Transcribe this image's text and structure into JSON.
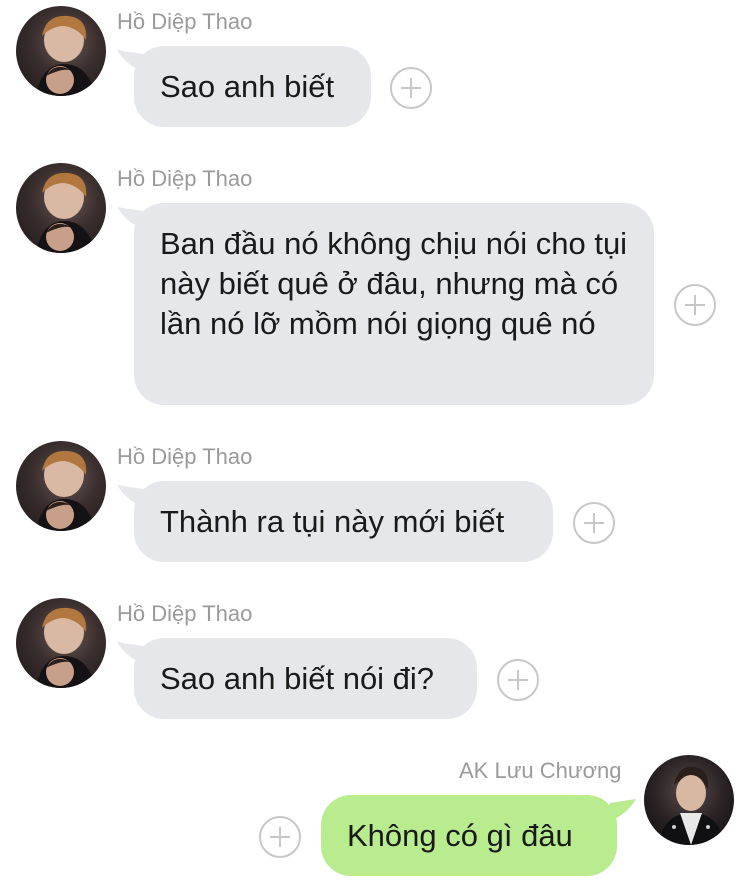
{
  "messages": [
    {
      "sender": "Hồ Diệp Thao",
      "text": "Sao anh biết",
      "direction": "incoming"
    },
    {
      "sender": "Hồ Diệp Thao",
      "text": "Ban đầu nó không chịu nói cho tụi này biết quê ở đâu, nhưng mà có lần nó lỡ mồm nói giọng quê nó",
      "direction": "incoming"
    },
    {
      "sender": "Hồ Diệp Thao",
      "text": "Thành ra tụi này mới biết",
      "direction": "incoming"
    },
    {
      "sender": "Hồ Diệp Thao",
      "text": "Sao anh biết nói đi?",
      "direction": "incoming"
    },
    {
      "sender": "AK Lưu Chương",
      "text": "Không có gì đâu",
      "direction": "outgoing"
    }
  ],
  "colors": {
    "incoming_bubble": "#e5e7eb",
    "outgoing_bubble": "#b9ec8e",
    "sender_name": "#9a9a9a",
    "text": "#1a1a1a"
  },
  "icons": {
    "reaction": "plus-circle-icon",
    "avatar": "avatar-photo"
  }
}
